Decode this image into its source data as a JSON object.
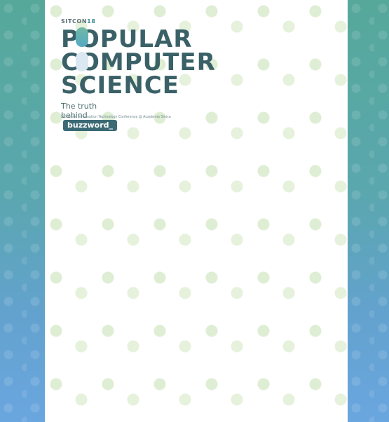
{
  "brand": {
    "sitcon_prefix": "SITCON",
    "sitcon_suffix": "18",
    "title_line1": "POPULAR",
    "title_line2": "COMPUTER",
    "title_line3": "SCIENCE",
    "tagline_prefix": "The truth behind",
    "tagline_badge": "buzzword_",
    "subline": "Students' Information Technology Conference @ Academia Sinica"
  },
  "colors": {
    "side_gradient_top": "#56a89a",
    "side_gradient_bottom": "#6aa6df",
    "panel": "#ffffff",
    "title": "#3a6167"
  }
}
